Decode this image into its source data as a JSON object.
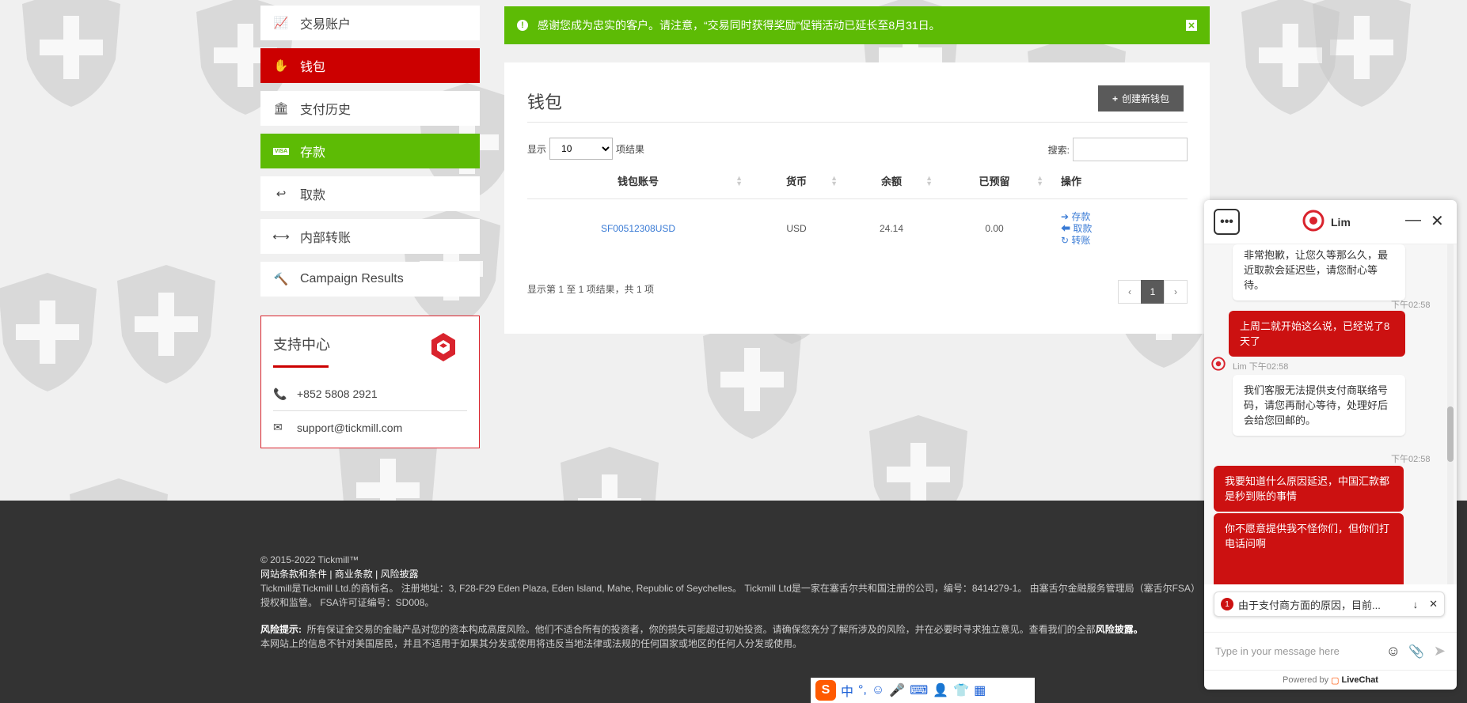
{
  "sidebar": {
    "items": [
      {
        "label": "交易账户",
        "icon": "chart-icon"
      },
      {
        "label": "钱包",
        "icon": "wallet-icon"
      },
      {
        "label": "支付历史",
        "icon": "bank-icon"
      },
      {
        "label": "存款",
        "icon": "visa-card-icon"
      },
      {
        "label": "取款",
        "icon": "reply-arrow-icon"
      },
      {
        "label": "内部转账",
        "icon": "transfer-arrows-icon"
      },
      {
        "label": "Campaign Results",
        "icon": "gavel-icon"
      }
    ],
    "support": {
      "title": "支持中心",
      "phone": "+852 5808 2921",
      "email": "support@tickmill.com"
    }
  },
  "notice": {
    "text": "感谢您成为忠实的客户。请注意，“交易同时获得奖励”促销活动已延长至8月31日。"
  },
  "wallet": {
    "title": "钱包",
    "create_label": "创建新钱包",
    "show_label": "显示",
    "page_size": "10",
    "results_label": "项结果",
    "search_label": "搜索:",
    "columns": [
      "钱包账号",
      "货币",
      "余额",
      "已预留",
      "操作"
    ],
    "rows": [
      {
        "account": "SF00512308USD",
        "currency": "USD",
        "balance": "24.14",
        "reserved": "0.00",
        "actions": [
          "存款",
          "取款",
          "转账"
        ]
      }
    ],
    "info": "显示第 1 至 1 项结果，共 1 项",
    "pager": {
      "prev": "‹",
      "current": "1",
      "next": "›"
    }
  },
  "footer": {
    "copyright": "© 2015-2022 Tickmill™",
    "links": "网站条款和条件 | 商业条款 | 风险披露",
    "legal": "Tickmill是Tickmill Ltd.的商标名。 注册地址：3, F28-F29 Eden Plaza, Eden Island, Mahe, Republic of Seychelles。 Tickmill Ltd是一家在塞舌尔共和国注册的公司，编号：8414279-1。 由塞舌尔金融服务管理局（塞舌尔FSA）授权和监管。 FSA许可证编号：SD008。",
    "risk_label": "风险提示:",
    "risk_text": "所有保证金交易的金融产品对您的资本构成高度风险。他们不适合所有的投资者，你的损失可能超过初始投资。请确保您充分了解所涉及的风险，并在必要时寻求独立意见。查看我们的全部",
    "risk_link": "风险披露",
    "risk_end": "。",
    "us_notice": "本网站上的信息不针对美国居民，并且不适用于如果其分发或使用将违反当地法律或法规的任何国家或地区的任何人分发或使用。"
  },
  "chat": {
    "agent": "Lim",
    "messages": [
      {
        "dir": "in",
        "text": "非常抱歉，让您久等那么久，最近取款会延迟些，请您耐心等待。"
      },
      {
        "dir": "ts",
        "text": "下午02:58"
      },
      {
        "dir": "out",
        "text": "上周二就开始这么说，已经说了8天了"
      },
      {
        "dir": "ts",
        "text": "Lim 下午02:58"
      },
      {
        "dir": "in",
        "text": "我们客服无法提供支付商联络号码，请您再耐心等待，处理好后会给您回邮的。"
      },
      {
        "dir": "ts",
        "text": "下午02:58"
      },
      {
        "dir": "out",
        "text": "我要知道什么原因延迟，中国汇款都是秒到账的事情"
      },
      {
        "dir": "out",
        "text": "你不愿意提供我不怪你们，但你们打电话问啊"
      }
    ],
    "notification": {
      "count": "1",
      "text": "由于支付商方面的原因，目前..."
    },
    "input_placeholder": "Type in your message here",
    "powered_by": "Powered by",
    "brand": "LiveChat"
  },
  "ime": {
    "items": [
      "中",
      "°,",
      "☺",
      "🎤",
      "⌨",
      "👤",
      "👕",
      "▦"
    ]
  }
}
